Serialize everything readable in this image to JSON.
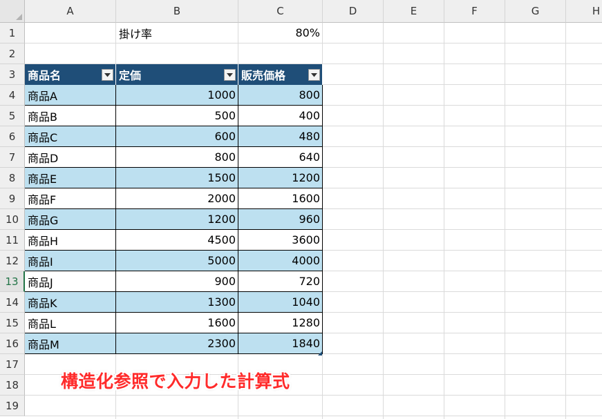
{
  "columns": [
    "A",
    "B",
    "C",
    "D",
    "E",
    "F",
    "G",
    "H"
  ],
  "rows": [
    "1",
    "2",
    "3",
    "4",
    "5",
    "6",
    "7",
    "8",
    "9",
    "10",
    "11",
    "12",
    "13",
    "14",
    "15",
    "16",
    "17",
    "18",
    "19"
  ],
  "active_row": "13",
  "cells": {
    "B1": "掛け率",
    "C1": "80%"
  },
  "table": {
    "headers": [
      "商品名",
      "定価",
      "販売価格"
    ],
    "rows": [
      [
        "商品A",
        "1000",
        "800"
      ],
      [
        "商品B",
        "500",
        "400"
      ],
      [
        "商品C",
        "600",
        "480"
      ],
      [
        "商品D",
        "800",
        "640"
      ],
      [
        "商品E",
        "1500",
        "1200"
      ],
      [
        "商品F",
        "2000",
        "1600"
      ],
      [
        "商品G",
        "1200",
        "960"
      ],
      [
        "商品H",
        "4500",
        "3600"
      ],
      [
        "商品I",
        "5000",
        "4000"
      ],
      [
        "商品J",
        "900",
        "720"
      ],
      [
        "商品K",
        "1300",
        "1040"
      ],
      [
        "商品L",
        "1600",
        "1280"
      ],
      [
        "商品M",
        "2300",
        "1840"
      ]
    ]
  },
  "caption": "構造化参照で入力した計算式",
  "colors": {
    "table_header": "#1f4e78",
    "band": "#bde0f0",
    "caption": "#ff2a2a"
  },
  "icons": {
    "filter": "dropdown-arrow-icon"
  }
}
